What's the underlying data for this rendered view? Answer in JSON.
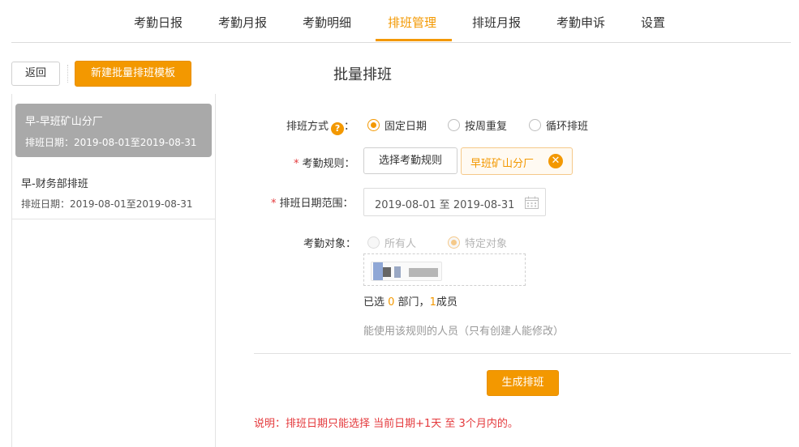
{
  "nav": {
    "tabs": [
      {
        "label": "考勤日报"
      },
      {
        "label": "考勤月报"
      },
      {
        "label": "考勤明细"
      },
      {
        "label": "排班管理",
        "active": true
      },
      {
        "label": "排班月报"
      },
      {
        "label": "考勤申诉"
      },
      {
        "label": "设置"
      }
    ],
    "accent_color": "#f39800"
  },
  "left": {
    "back_label": "返回",
    "new_template_label": "新建批量排班模板",
    "templates": [
      {
        "name": "早-早班矿山分厂",
        "dates": "排班日期：2019-08-01至2019-08-31",
        "selected": true
      },
      {
        "name": "早-财务部排班",
        "dates": "排班日期：2019-08-01至2019-08-31",
        "selected": false
      }
    ]
  },
  "main": {
    "title": "批量排班",
    "schedule_mode": {
      "label": "排班方式",
      "help_icon": "?",
      "colon": "：",
      "options": [
        {
          "label": "固定日期",
          "checked": true
        },
        {
          "label": "按周重复",
          "checked": false
        },
        {
          "label": "循环排班",
          "checked": false
        }
      ]
    },
    "rule": {
      "required_mark": "*",
      "label": "考勤规则：",
      "choose_button": "选择考勤规则",
      "selected_tag": "早班矿山分厂",
      "tag_close": "✕"
    },
    "date_range": {
      "required_mark": "*",
      "label": "排班日期范围：",
      "value": "2019-08-01 至 2019-08-31"
    },
    "target": {
      "label": "考勤对象：",
      "options": [
        {
          "label": "所有人",
          "checked": false,
          "disabled": true
        },
        {
          "label": "特定对象",
          "checked": true,
          "disabled": true
        }
      ]
    },
    "selected_count": {
      "prefix": "已选 ",
      "dept_count": "0",
      "dept_suffix": " 部门，",
      "member_count": "1",
      "member_suffix": "成员"
    },
    "hint": "能使用该规则的人员（只有创建人能修改）",
    "generate_button": "生成排班",
    "note": "说明：排班日期只能选择 当前日期+1天 至 3个月内的。"
  }
}
